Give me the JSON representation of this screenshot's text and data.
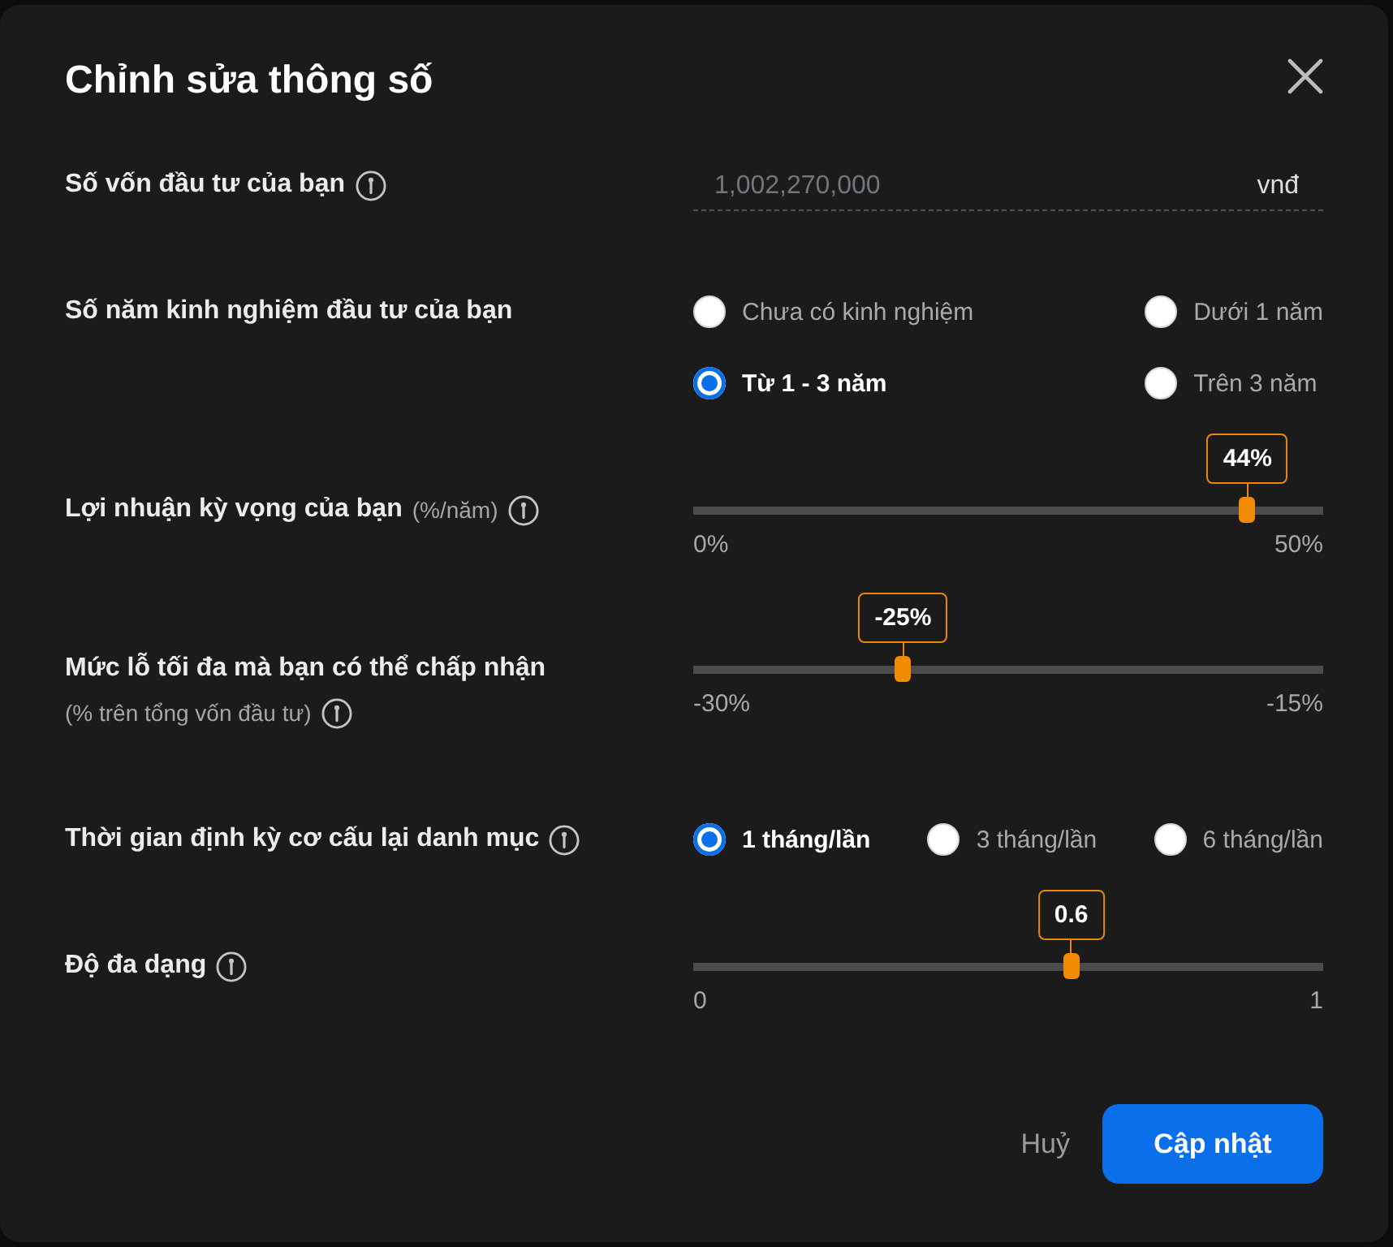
{
  "dialog": {
    "title": "Chỉnh sửa thông số"
  },
  "fields": [
    {
      "kind": "amount",
      "label": "Số vốn đầu tư của bạn",
      "info": true,
      "value": "1,002,270,000",
      "unit": "vnđ"
    },
    {
      "kind": "radio_grid",
      "label": "Số năm kinh nghiệm đầu tư của bạn",
      "info": false,
      "options": [
        {
          "label": "Chưa có kinh nghiệm",
          "selected": false
        },
        {
          "label": "Dưới 1 năm",
          "selected": false
        },
        {
          "label": "Từ 1 - 3 năm",
          "selected": true
        },
        {
          "label": "Trên 3 năm",
          "selected": false
        }
      ]
    },
    {
      "kind": "slider",
      "label": "Lợi nhuận kỳ vọng của bạn",
      "suffix": "(%/năm)",
      "info": true,
      "level": 0.88,
      "reading": "44%",
      "min_label": "0%",
      "max_label": "50%"
    },
    {
      "kind": "slider",
      "label": "Mức lỗ tối đa mà bạn có thể chấp nhận",
      "note": "(% trên tổng vốn đầu tư)",
      "info": true,
      "level": 0.333,
      "reading": "-25%",
      "min_label": "-30%",
      "max_label": "-15%"
    },
    {
      "kind": "radio_row",
      "label": "Thời gian định kỳ cơ cấu lại danh mục",
      "info": true,
      "options": [
        {
          "label": "1 tháng/lần",
          "selected": true
        },
        {
          "label": "3 tháng/lần",
          "selected": false
        },
        {
          "label": "6 tháng/lần",
          "selected": false
        }
      ]
    },
    {
      "kind": "slider",
      "label": "Độ đa dạng",
      "info": true,
      "level": 0.6,
      "reading": "0.6",
      "min_label": "0",
      "max_label": "1"
    }
  ],
  "buttons": [
    {
      "kind": "text",
      "label": "Huỷ"
    },
    {
      "kind": "primary",
      "label": "Cập nhật"
    }
  ]
}
